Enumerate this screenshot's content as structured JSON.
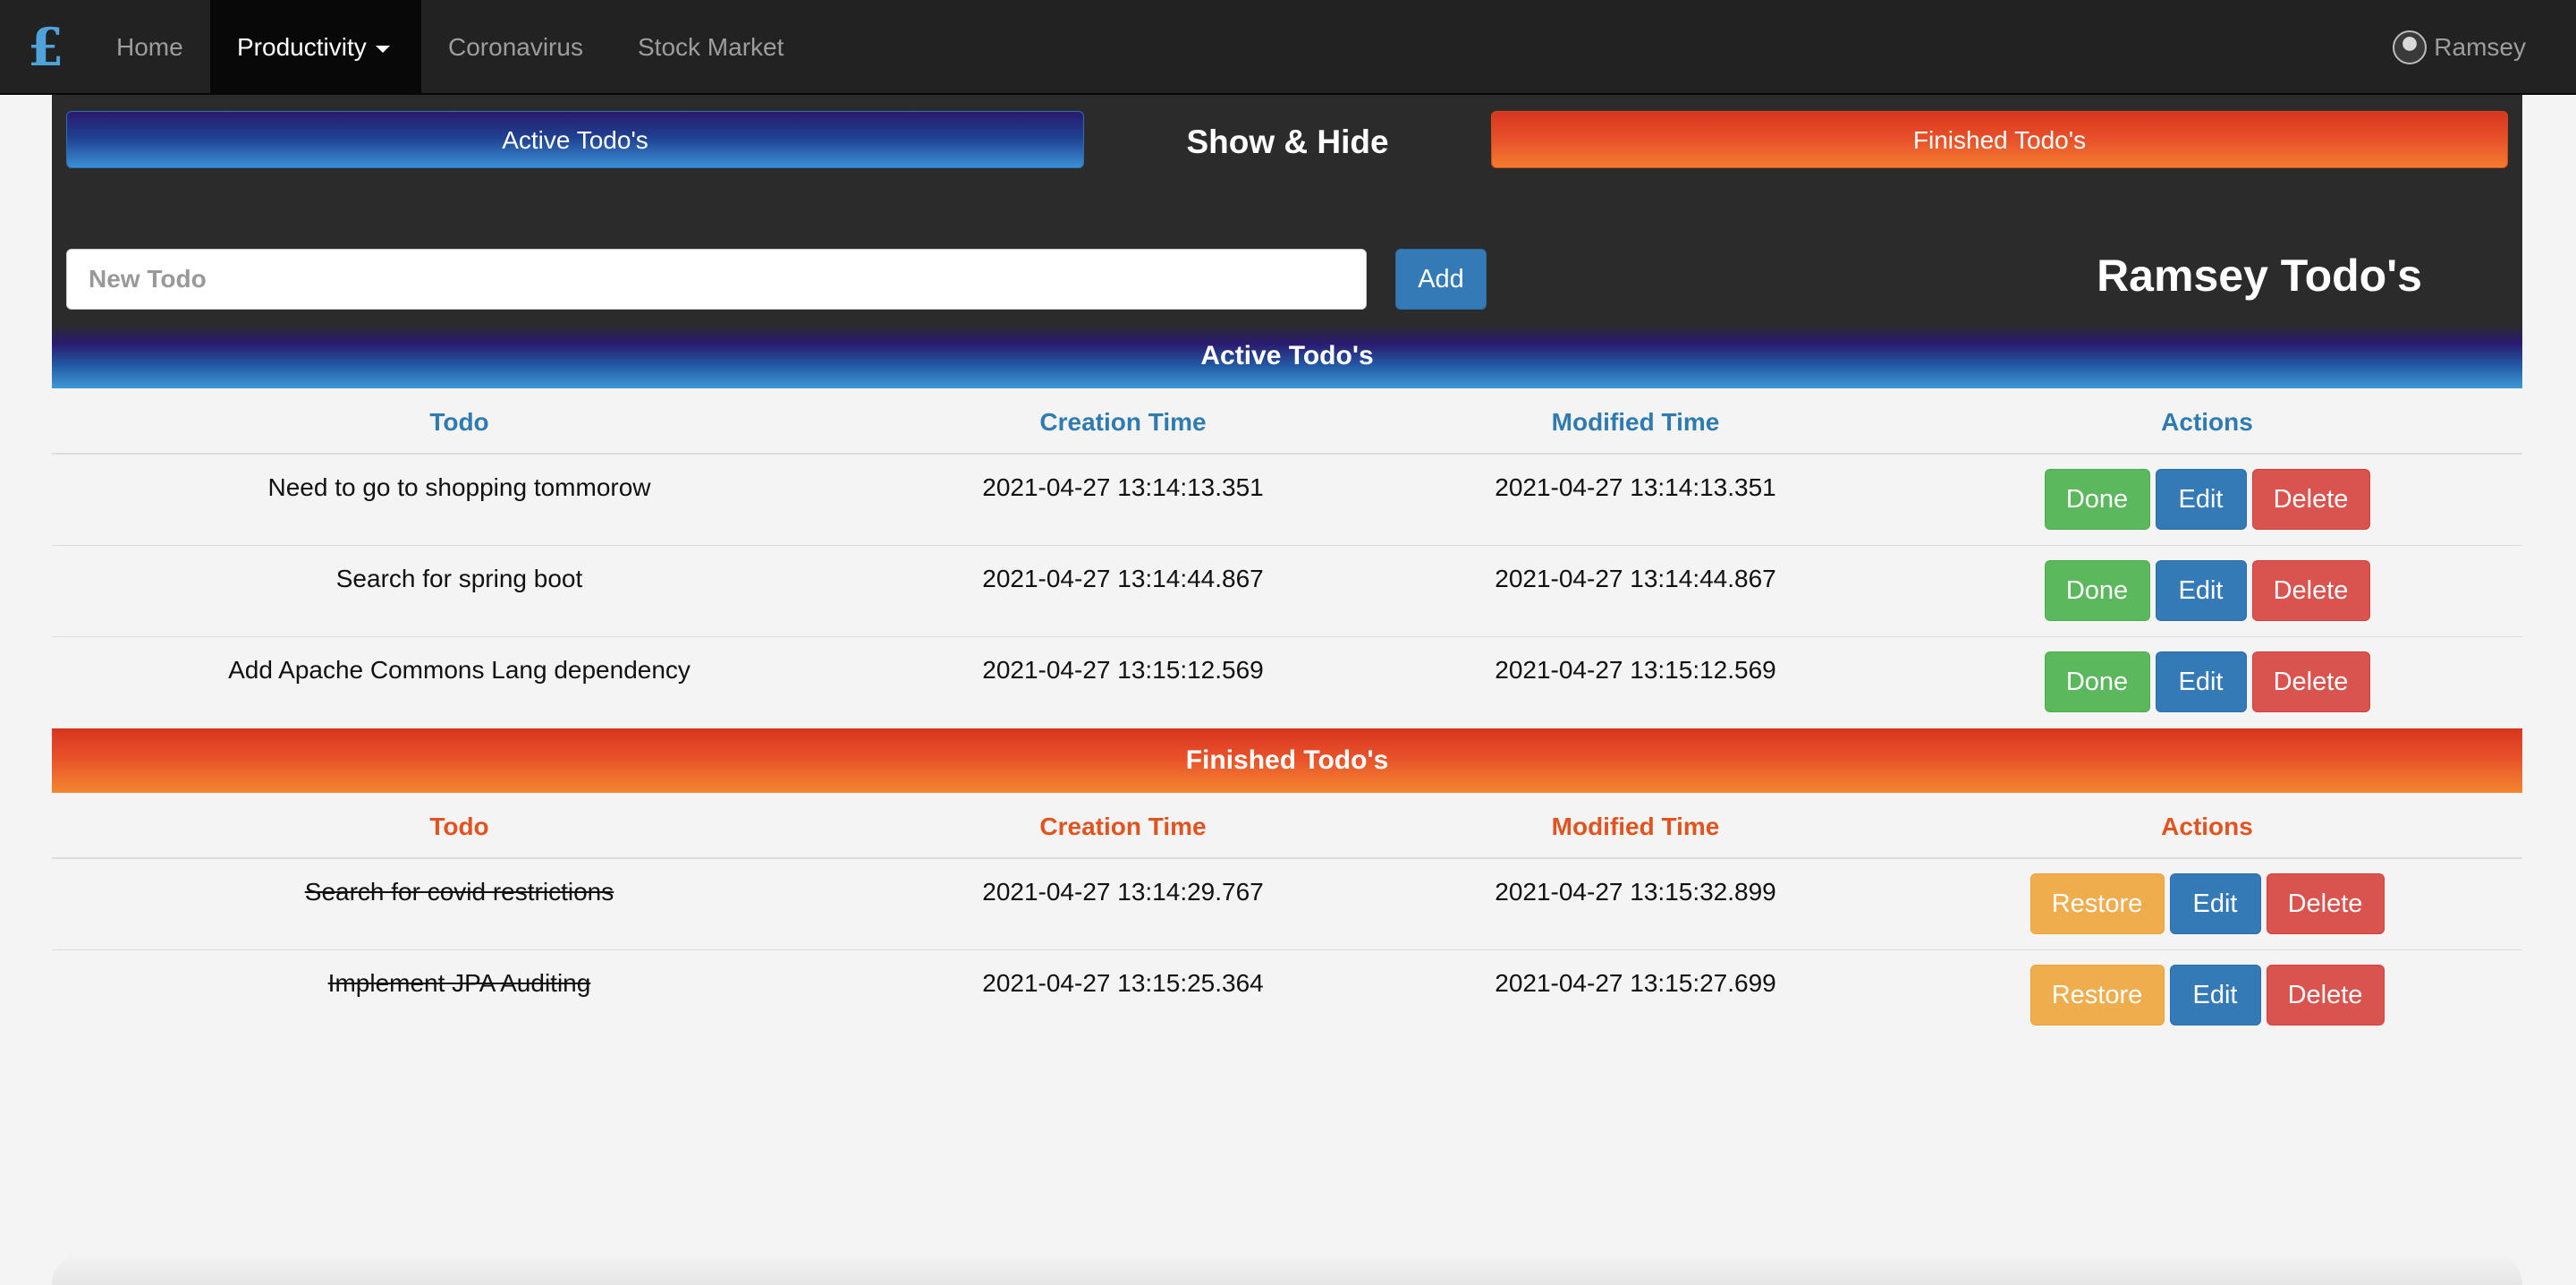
{
  "nav": {
    "brand_glyph": "£",
    "items": [
      {
        "label": "Home"
      },
      {
        "label": "Productivity"
      },
      {
        "label": "Coronavirus"
      },
      {
        "label": "Stock Market"
      }
    ],
    "user_name": "Ramsey"
  },
  "header": {
    "active_toggle_label": "Active Todo's",
    "show_hide_label": "Show & Hide",
    "finished_toggle_label": "Finished Todo's",
    "new_todo_placeholder": "New Todo",
    "add_label": "Add",
    "title": "Ramsey Todo's"
  },
  "active": {
    "banner": "Active Todo's",
    "columns": [
      "Todo",
      "Creation Time",
      "Modified Time",
      "Actions"
    ],
    "rows": [
      {
        "todo": "Need to go to shopping tommorow",
        "created": "2021-04-27 13:14:13.351",
        "modified": "2021-04-27 13:14:13.351"
      },
      {
        "todo": "Search for spring boot",
        "created": "2021-04-27 13:14:44.867",
        "modified": "2021-04-27 13:14:44.867"
      },
      {
        "todo": "Add Apache Commons Lang dependency",
        "created": "2021-04-27 13:15:12.569",
        "modified": "2021-04-27 13:15:12.569"
      }
    ],
    "done_label": "Done",
    "edit_label": "Edit",
    "delete_label": "Delete"
  },
  "finished": {
    "banner": "Finished Todo's",
    "columns": [
      "Todo",
      "Creation Time",
      "Modified Time",
      "Actions"
    ],
    "rows": [
      {
        "todo": "Search for covid restrictions",
        "created": "2021-04-27 13:14:29.767",
        "modified": "2021-04-27 13:15:32.899"
      },
      {
        "todo": "Implement JPA Auditing",
        "created": "2021-04-27 13:15:25.364",
        "modified": "2021-04-27 13:15:27.699"
      }
    ],
    "restore_label": "Restore",
    "edit_label": "Edit",
    "delete_label": "Delete"
  },
  "colors": {
    "navbar": "#222222",
    "panel": "#2b2b2b",
    "active_accent": "#2f7bb0",
    "finished_accent": "#e2541f",
    "done": "#5cb85c",
    "edit": "#337ab7",
    "delete": "#d9534f",
    "restore": "#f0ad4e"
  }
}
